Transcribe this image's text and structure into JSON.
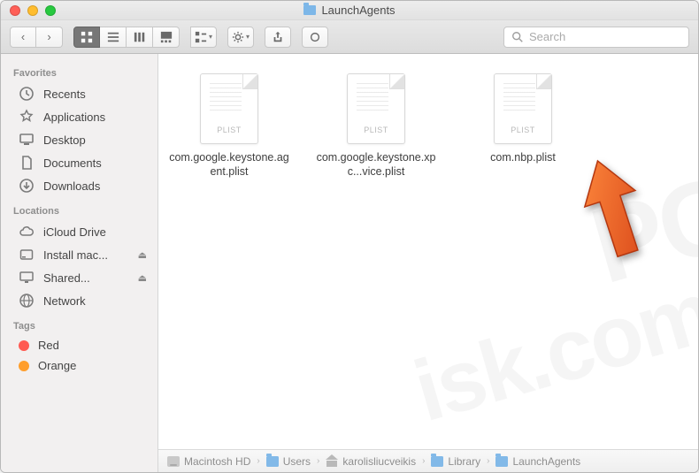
{
  "window": {
    "title": "LaunchAgents"
  },
  "toolbar": {
    "view_modes": [
      "icon",
      "list",
      "column",
      "gallery"
    ],
    "active_view": "icon",
    "search_placeholder": "Search"
  },
  "sidebar": {
    "sections": [
      {
        "header": "Favorites",
        "items": [
          {
            "icon": "recents-icon",
            "label": "Recents"
          },
          {
            "icon": "applications-icon",
            "label": "Applications"
          },
          {
            "icon": "desktop-icon",
            "label": "Desktop"
          },
          {
            "icon": "documents-icon",
            "label": "Documents"
          },
          {
            "icon": "downloads-icon",
            "label": "Downloads"
          }
        ]
      },
      {
        "header": "Locations",
        "items": [
          {
            "icon": "icloud-icon",
            "label": "iCloud Drive"
          },
          {
            "icon": "disk-icon",
            "label": "Install mac...",
            "eject": true
          },
          {
            "icon": "shared-icon",
            "label": "Shared...",
            "eject": true
          },
          {
            "icon": "network-icon",
            "label": "Network"
          }
        ]
      },
      {
        "header": "Tags",
        "items": [
          {
            "icon": "tag-dot",
            "color": "#ff5b52",
            "label": "Red"
          },
          {
            "icon": "tag-dot",
            "color": "#ff9e2c",
            "label": "Orange"
          }
        ]
      }
    ]
  },
  "files": [
    {
      "kind": "PLIST",
      "name": "com.google.keystone.agent.plist"
    },
    {
      "kind": "PLIST",
      "name": "com.google.keystone.xpc...vice.plist"
    },
    {
      "kind": "PLIST",
      "name": "com.nbp.plist"
    }
  ],
  "annotation": {
    "arrow_points_to_file_index": 2
  },
  "pathbar": [
    {
      "icon": "hd",
      "label": "Macintosh HD"
    },
    {
      "icon": "fd",
      "label": "Users"
    },
    {
      "icon": "home",
      "label": "karolisliucveikis"
    },
    {
      "icon": "fd",
      "label": "Library"
    },
    {
      "icon": "fd",
      "label": "LaunchAgents"
    }
  ]
}
